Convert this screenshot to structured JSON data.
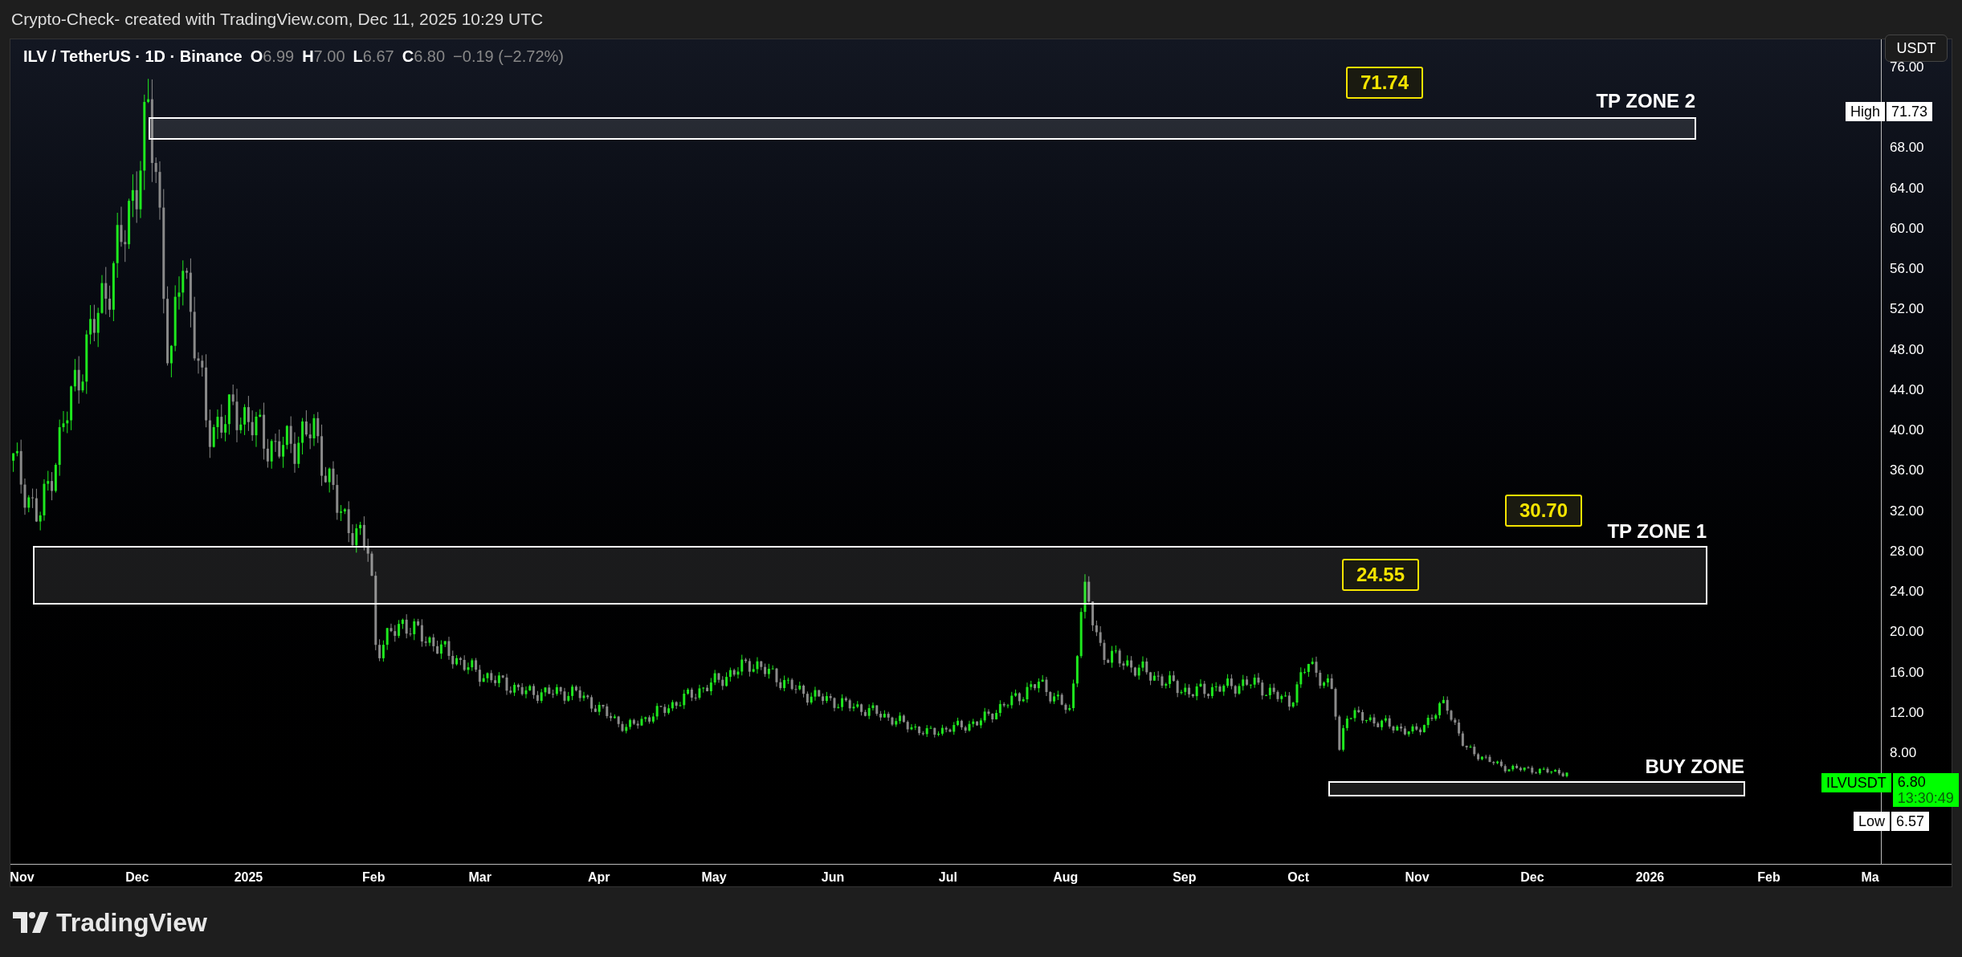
{
  "header": {
    "text": "Crypto-Check- created with TradingView.com, Dec 11, 2025 10:29 UTC"
  },
  "legend": {
    "symbol": "ILV / TetherUS · 1D · Binance",
    "fields": [
      {
        "label": "O",
        "value": "6.99"
      },
      {
        "label": "H",
        "value": "7.00"
      },
      {
        "label": "L",
        "value": "6.67"
      },
      {
        "label": "C",
        "value": "6.80"
      }
    ],
    "change": "−0.19 (−2.72%)"
  },
  "currency_button": "USDT",
  "price_axis": [
    "76.00",
    "68.00",
    "64.00",
    "60.00",
    "56.00",
    "52.00",
    "48.00",
    "44.00",
    "40.00",
    "36.00",
    "32.00",
    "28.00",
    "24.00",
    "20.00",
    "16.00",
    "12.00",
    "8.00"
  ],
  "time_axis": [
    "Nov",
    "Dec",
    "2025",
    "Feb",
    "Mar",
    "Apr",
    "May",
    "Jun",
    "Jul",
    "Aug",
    "Sep",
    "Oct",
    "Nov",
    "Dec",
    "2026",
    "Feb",
    "Ma"
  ],
  "zones": [
    {
      "label": "TP ZONE 2"
    },
    {
      "label": "TP ZONE 1"
    },
    {
      "label": "BUY ZONE"
    }
  ],
  "callouts": [
    "71.74",
    "30.70",
    "24.55"
  ],
  "markers": {
    "high": {
      "label": "High",
      "value": "71.73"
    },
    "last": {
      "symbol": "ILVUSDT",
      "value": "6.80",
      "countdown": "13:30:49"
    },
    "low": {
      "label": "Low",
      "value": "6.57"
    }
  },
  "logo": {
    "text": "TradingView"
  }
}
